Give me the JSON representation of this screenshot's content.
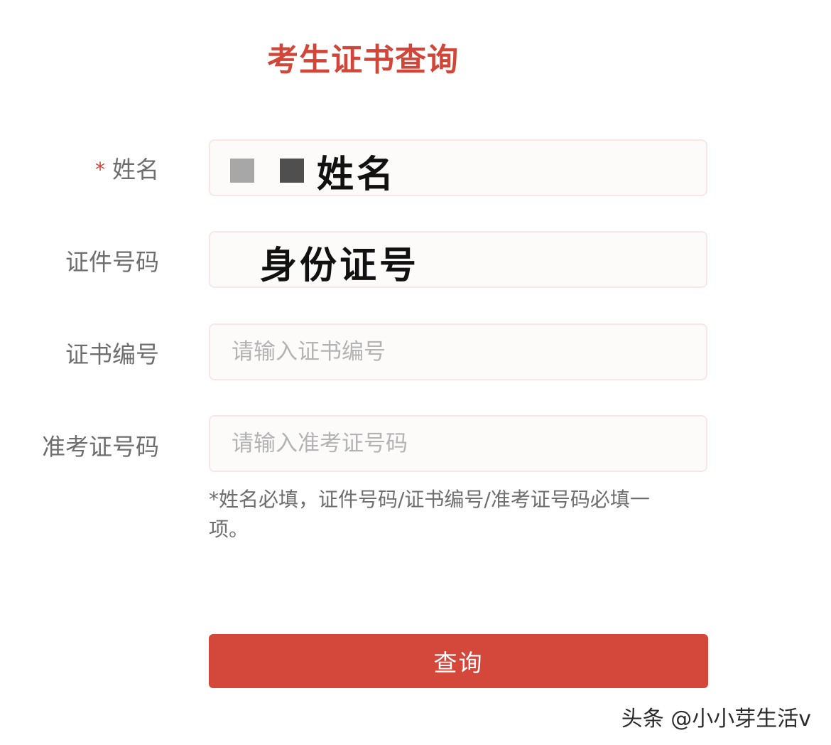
{
  "page": {
    "title": "考生证书查询"
  },
  "form": {
    "name": {
      "required_mark": "*",
      "label": "姓名",
      "handwritten_value": "姓名"
    },
    "id_number": {
      "label": "证件号码",
      "handwritten_value": "身份证号"
    },
    "cert_number": {
      "label": "证书编号",
      "placeholder": "请输入证书编号"
    },
    "exam_number": {
      "label": "准考证号码",
      "placeholder": "请输入准考证号码"
    },
    "hint": "*姓名必填，证件号码/证书编号/准考证号码必填一项。",
    "submit_label": "查询"
  },
  "watermark": "头条 @小小芽生活v",
  "colors": {
    "accent": "#d4473b",
    "title": "#d2463a",
    "label": "#6e6e6e",
    "placeholder": "#b3b3b3",
    "input_border": "#f8e7e6"
  }
}
